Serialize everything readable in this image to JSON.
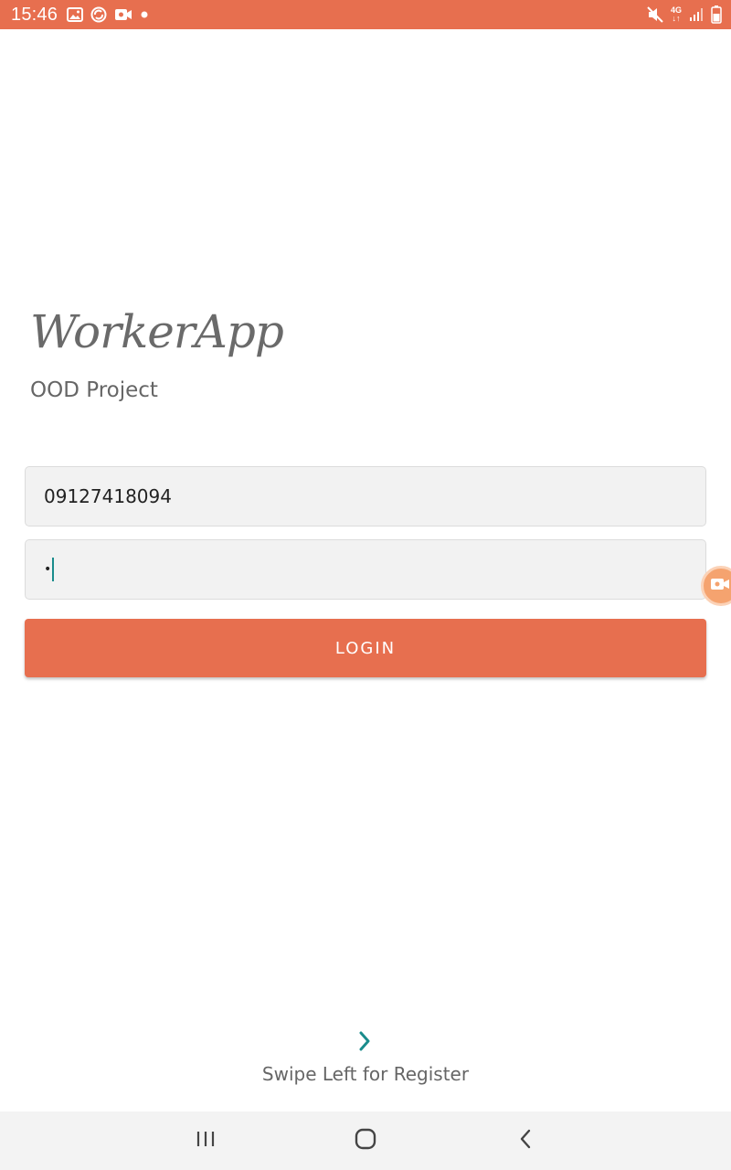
{
  "status_bar": {
    "time": "15:46",
    "network_label_top": "4G",
    "network_label_bottom": "↓↑",
    "left_icons": [
      "image-icon",
      "sync-icon",
      "video-record-icon",
      "dot-icon"
    ],
    "right_icons": [
      "mute-icon",
      "network-4g-icon",
      "signal-icon",
      "battery-icon"
    ],
    "color": "#e76f4f"
  },
  "app": {
    "logo_text": "WorkerApp",
    "subtitle": "OOD Project"
  },
  "form": {
    "phone_value": "09127418094",
    "password_mask": "•",
    "login_label": "LOGIN",
    "accent_color": "#e76f4f",
    "caret_color": "#1a8c8c"
  },
  "swipe": {
    "label": "Swipe Left for Register",
    "icon": "chevron-right-icon"
  },
  "nav_bar": {
    "buttons": [
      "recents-icon",
      "home-icon",
      "back-icon"
    ]
  }
}
